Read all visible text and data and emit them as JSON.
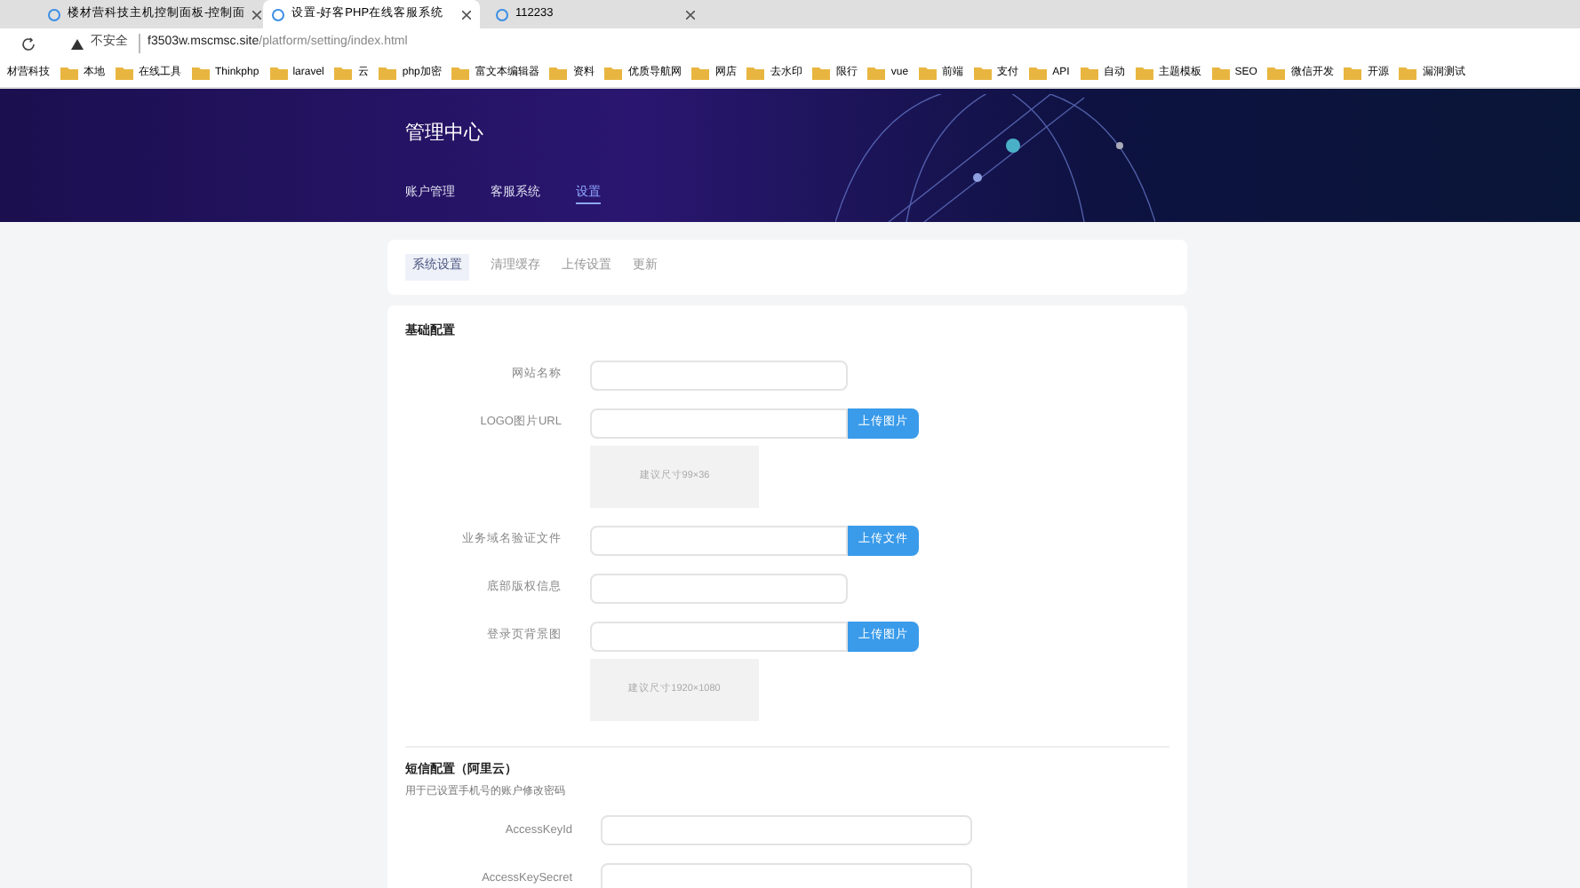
{
  "browser": {
    "tabs": [
      {
        "title": "楼材营科技主机控制面板-控制面",
        "selected": false
      },
      {
        "title": "设置-好客PHP在线客服系统",
        "selected": true
      },
      {
        "title": "112233",
        "selected": false
      }
    ],
    "security": "不安全",
    "url_host": "f3503w.mscmsc.site",
    "url_path": "/platform/setting/index.html",
    "bookmarks": [
      "材营科技",
      "本地",
      "在线工具",
      "Thinkphp",
      "laravel",
      "云",
      "php加密",
      "富文本编辑器",
      "资料",
      "优质导航网",
      "网店",
      "去水印",
      "限行",
      "vue",
      "前端",
      "支付",
      "API",
      "自动",
      "主题模板",
      "SEO",
      "微信开发",
      "开源",
      "漏洞测试"
    ]
  },
  "header": {
    "title": "管理中心",
    "nav": [
      {
        "label": "账户管理",
        "selected": false
      },
      {
        "label": "客服系统",
        "selected": false
      },
      {
        "label": "设置",
        "selected": true
      }
    ]
  },
  "subtabs": [
    {
      "label": "系统设置",
      "selected": true
    },
    {
      "label": "清理缓存",
      "selected": false
    },
    {
      "label": "上传设置",
      "selected": false
    },
    {
      "label": "更新",
      "selected": false
    }
  ],
  "sections": [
    {
      "title": "基础配置",
      "fields": [
        {
          "label": "网站名称",
          "kind": "text"
        },
        {
          "label": "LOGO图片URL",
          "kind": "upload",
          "button": "上传图片",
          "hint": "建议尺寸99×36"
        },
        {
          "label": "业务域名验证文件",
          "kind": "upload",
          "button": "上传文件"
        },
        {
          "label": "底部版权信息",
          "kind": "text"
        },
        {
          "label": "登录页背景图",
          "kind": "upload",
          "button": "上传图片",
          "hint": "建议尺寸1920×1080"
        }
      ]
    },
    {
      "title": "短信配置（阿里云）",
      "subtitle": "用于已设置手机号的账户修改密码",
      "fields": [
        {
          "label": "AccessKeyId",
          "kind": "text"
        },
        {
          "label": "AccessKeySecret",
          "kind": "text"
        }
      ]
    }
  ]
}
